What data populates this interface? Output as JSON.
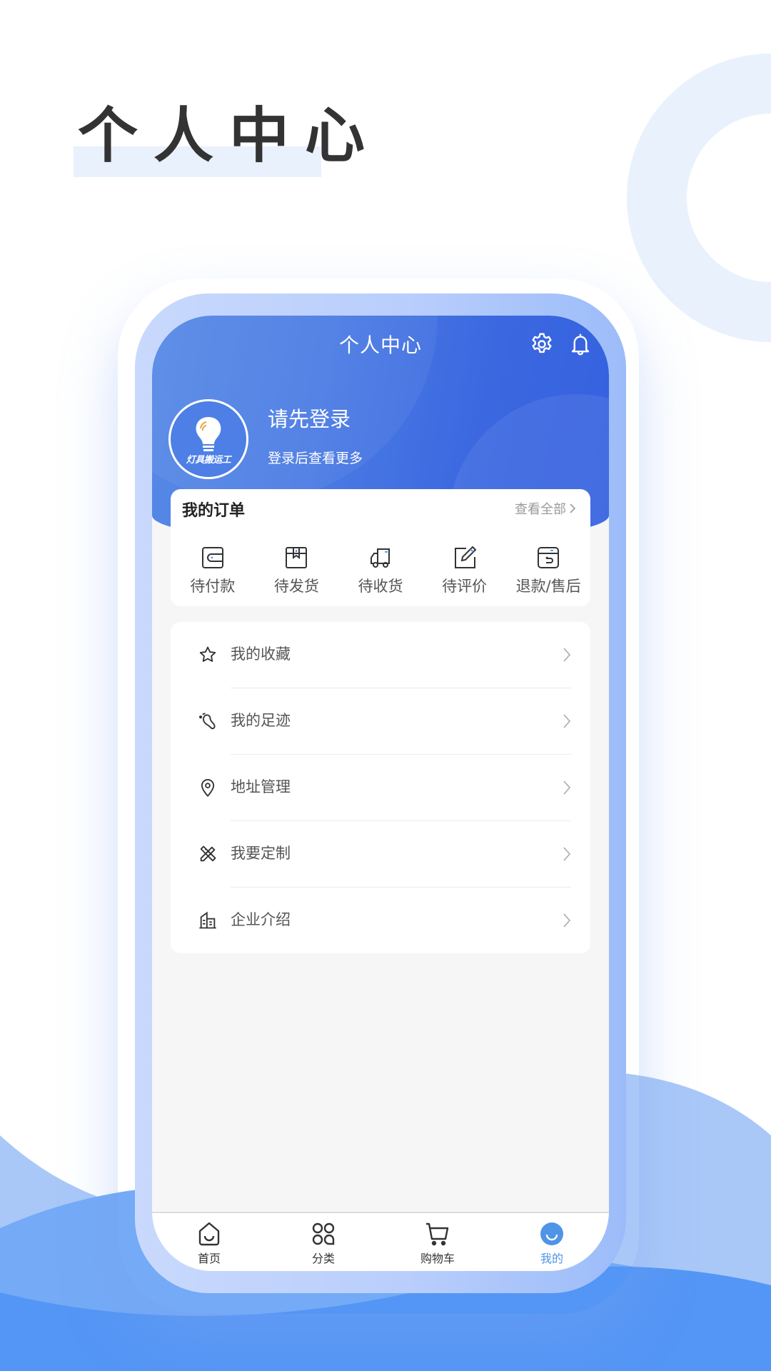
{
  "poster": {
    "title": "个人中心",
    "colors": {
      "highlight": "#e9f1fd",
      "wave_dark": "#5496f5",
      "wave_light": "#a9c8f8"
    }
  },
  "screen": {
    "title": "个人中心",
    "header_icons": [
      "gear-icon",
      "bell-icon"
    ],
    "profile": {
      "avatar_text": "灯具搬运工",
      "login_prompt": "请先登录",
      "login_subtitle": "登录后查看更多"
    },
    "orders": {
      "title": "我的订单",
      "view_all": "查看全部",
      "items": [
        {
          "label": "待付款",
          "icon": "wallet-icon"
        },
        {
          "label": "待发货",
          "icon": "package-icon"
        },
        {
          "label": "待收货",
          "icon": "truck-icon"
        },
        {
          "label": "待评价",
          "icon": "edit-icon"
        },
        {
          "label": "退款/售后",
          "icon": "return-box-icon"
        }
      ]
    },
    "menu": [
      {
        "label": "我的收藏",
        "icon": "star-icon"
      },
      {
        "label": "我的足迹",
        "icon": "footprint-icon"
      },
      {
        "label": "地址管理",
        "icon": "location-pin-icon"
      },
      {
        "label": "我要定制",
        "icon": "ruler-pencil-icon"
      },
      {
        "label": "企业介绍",
        "icon": "building-icon"
      }
    ],
    "tabbar": {
      "active_index": 3,
      "active_color": "#4f94e6",
      "tabs": [
        {
          "label": "首页",
          "icon": "home-icon"
        },
        {
          "label": "分类",
          "icon": "category-icon"
        },
        {
          "label": "购物车",
          "icon": "cart-icon"
        },
        {
          "label": "我的",
          "icon": "profile-smile-icon"
        }
      ]
    },
    "colors": {
      "header_start": "#5789e6",
      "header_end": "#3561df",
      "accent_dot": "#4f94e6"
    }
  }
}
